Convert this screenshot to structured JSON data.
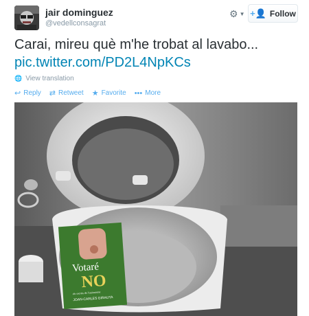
{
  "user": {
    "name": "jair dominguez",
    "handle": "@vedellconsagrat",
    "avatar_icon": "user-avatar"
  },
  "header": {
    "gear_icon": "gear-icon",
    "follow_label": "Follow"
  },
  "tweet": {
    "text": "Carai, mireu què m'he trobat al lavabo...",
    "link": "pic.twitter.com/PD2L4NpKCs",
    "translate_label": "View translation"
  },
  "actions": [
    {
      "label": "Reply",
      "icon": "reply-icon"
    },
    {
      "label": "Retweet",
      "icon": "retweet-icon"
    },
    {
      "label": "Favorite",
      "icon": "star-icon"
    },
    {
      "label": "More",
      "icon": "more-icon"
    }
  ],
  "photo": {
    "book": {
      "title_line1": "Votaré",
      "title_line2": "NO",
      "subtitle": "els secrets de l'unionisme",
      "author": "JOAN-CARLES GIRAUTA"
    }
  },
  "colors": {
    "link": "#0084b4",
    "action": "#55acee",
    "muted": "#8899a6",
    "book_green": "#3c7a2e"
  }
}
